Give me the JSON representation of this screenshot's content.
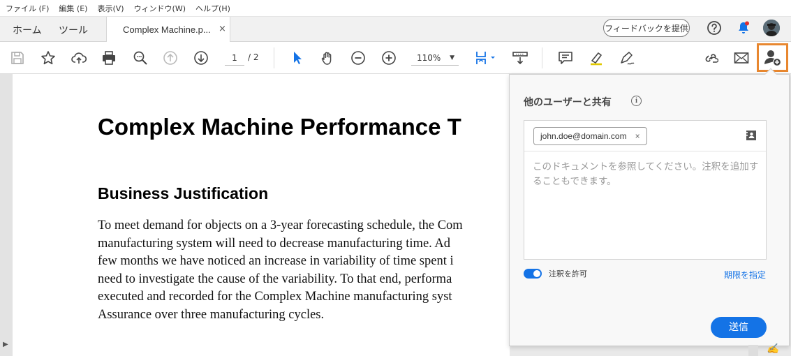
{
  "menu": [
    "ファイル (F)",
    "編集 (E)",
    "表示(V)",
    "ウィンドウ(W)",
    "ヘルプ(H)"
  ],
  "tabs": {
    "home": "ホーム",
    "tools": "ツール",
    "document": "Complex Machine.p...",
    "close": "×"
  },
  "header": {
    "feedback": "フィードバックを提供"
  },
  "toolbar": {
    "page_current": "1",
    "page_total": "/ 2",
    "zoom": "110%",
    "icons": [
      "save-icon",
      "bookmark-star-icon",
      "upload-cloud-icon",
      "print-icon",
      "zoom-search-icon",
      "page-up-icon",
      "page-down-icon",
      "select-cursor-icon",
      "hand-icon",
      "zoom-out-icon",
      "zoom-in-icon",
      "page-fit-icon",
      "scroll-mode-icon",
      "comment-icon",
      "highlight-icon",
      "sign-icon",
      "link-icon",
      "email-icon",
      "share-user-icon"
    ]
  },
  "document": {
    "title": "Complex Machine Performance T",
    "heading": "Business Justification",
    "lines": [
      "To meet demand for objects on a 3-year forecasting schedule, the Com",
      "manufacturing system will need to decrease manufacturing time. Ad",
      "few months we have noticed an increase in variability of time spent i",
      "need to investigate the cause of the variability. To that end, performa",
      "executed and recorded for the Complex Machine manufacturing syst",
      "Assurance over three manufacturing cycles."
    ]
  },
  "share": {
    "title": "他のユーザーと共有",
    "info": "i",
    "recipient": "john.doe@domain.com",
    "remove": "×",
    "message_placeholder": "このドキュメントを参照してください。注釈を追加することもできます。",
    "allow_comments": "注釈を許可",
    "allow_comments_on": true,
    "deadline": "期限を指定",
    "send": "送信"
  },
  "colors": {
    "accent": "#1473e6",
    "highlight_border": "#e8872f",
    "notification": "#e03030"
  }
}
